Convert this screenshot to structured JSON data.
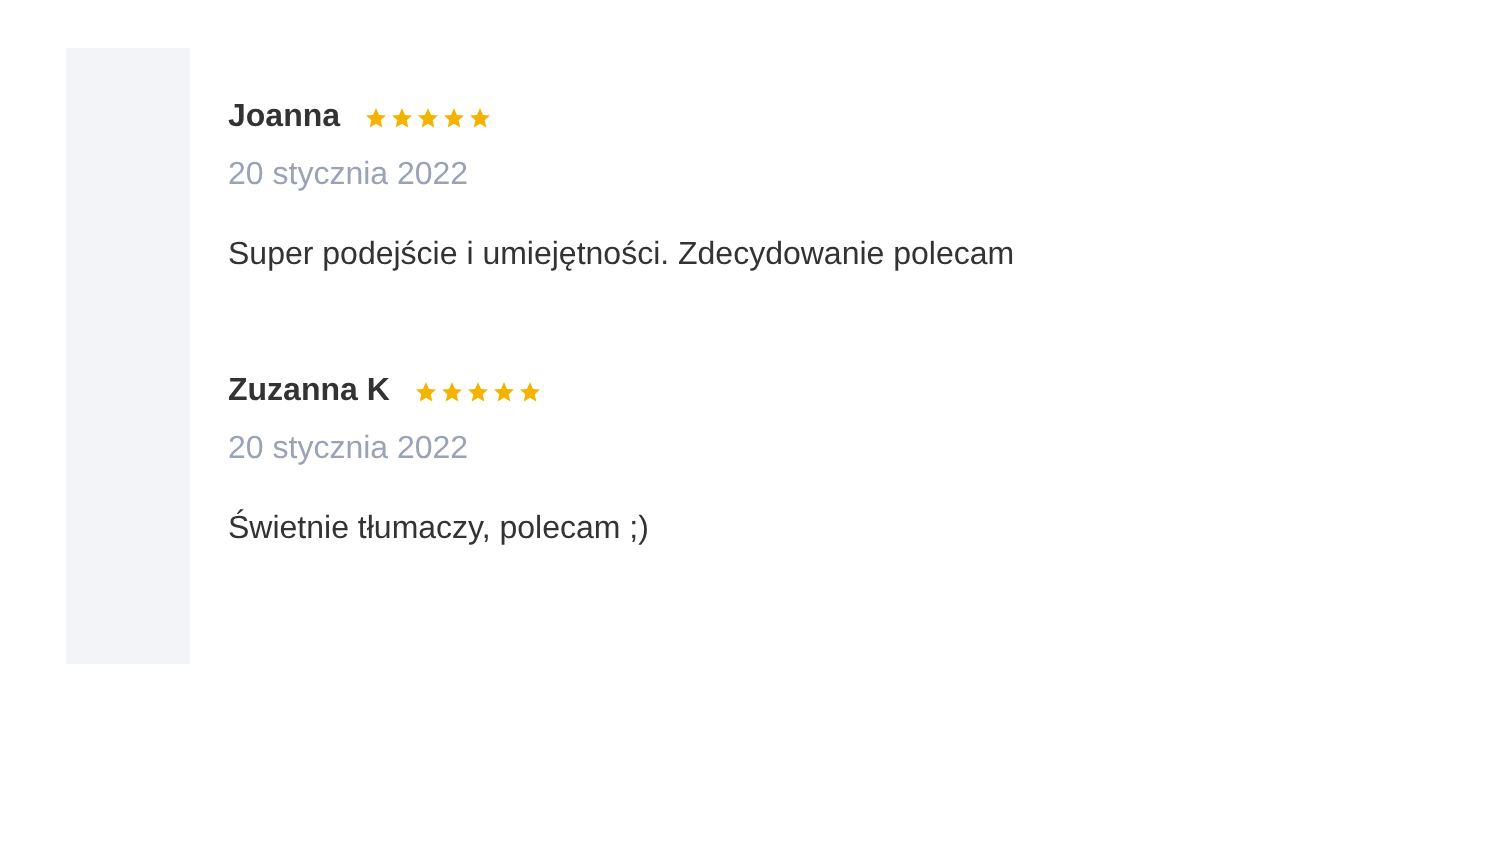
{
  "reviews": [
    {
      "author": "Joanna",
      "stars": 5,
      "date": "20 stycznia 2022",
      "text": "Super podejście i umiejętności. Zdecydowanie polecam"
    },
    {
      "author": "Zuzanna K",
      "stars": 5,
      "date": "20 stycznia 2022",
      "text": "Świetnie tłumaczy, polecam ;)"
    }
  ]
}
